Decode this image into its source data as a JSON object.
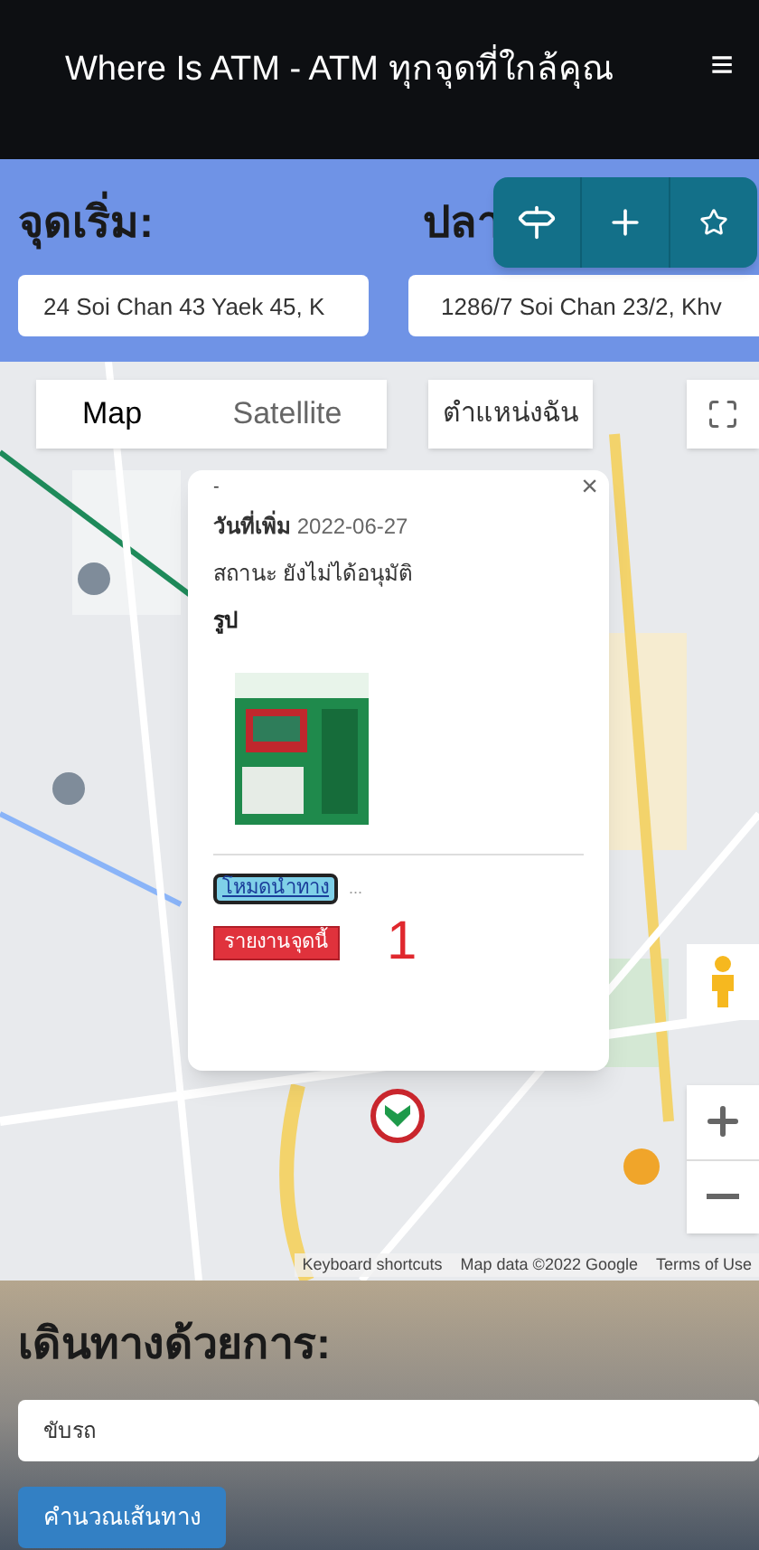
{
  "navbar": {
    "title": "Where Is ATM - ATM ทุกจุดที่ใกล้คุณ",
    "menu_icon": "≡"
  },
  "route_form": {
    "start_label": "จุดเริ่ม:",
    "end_label": "ปลา",
    "start_value": "24 Soi Chan 43 Yaek 45, K",
    "end_value": "1286/7 Soi Chan 23/2, Khv"
  },
  "fab_group": [
    {
      "kind": "signpost"
    },
    {
      "kind": "plus"
    },
    {
      "kind": "star"
    }
  ],
  "map": {
    "type_tabs": [
      {
        "label": "Map",
        "selected": true
      },
      {
        "label": "Satellite",
        "selected": false
      }
    ],
    "my_location_button": "ตำแหน่งฉัน",
    "popup": {
      "dash": "-",
      "close": "×",
      "date_label": "วันที่เพิ่ม",
      "date_value": "2022-06-27",
      "status_label": "สถานะ",
      "status_value": "ยังไม่ได้อนุมัติ",
      "image_label": "รูป",
      "navigate_button": "โหมดนำทาง",
      "ellipsis": "...",
      "report_button": "รายงานจุดนี้",
      "annotation": "1"
    },
    "attribution": [
      "Keyboard shortcuts",
      "Map data ©2022 Google",
      "Terms of Use"
    ]
  },
  "travel": {
    "heading": "เดินทางด้วยการ:",
    "mode_value": "ขับรถ",
    "calculate_button": "คำนวณเส้นทาง"
  }
}
